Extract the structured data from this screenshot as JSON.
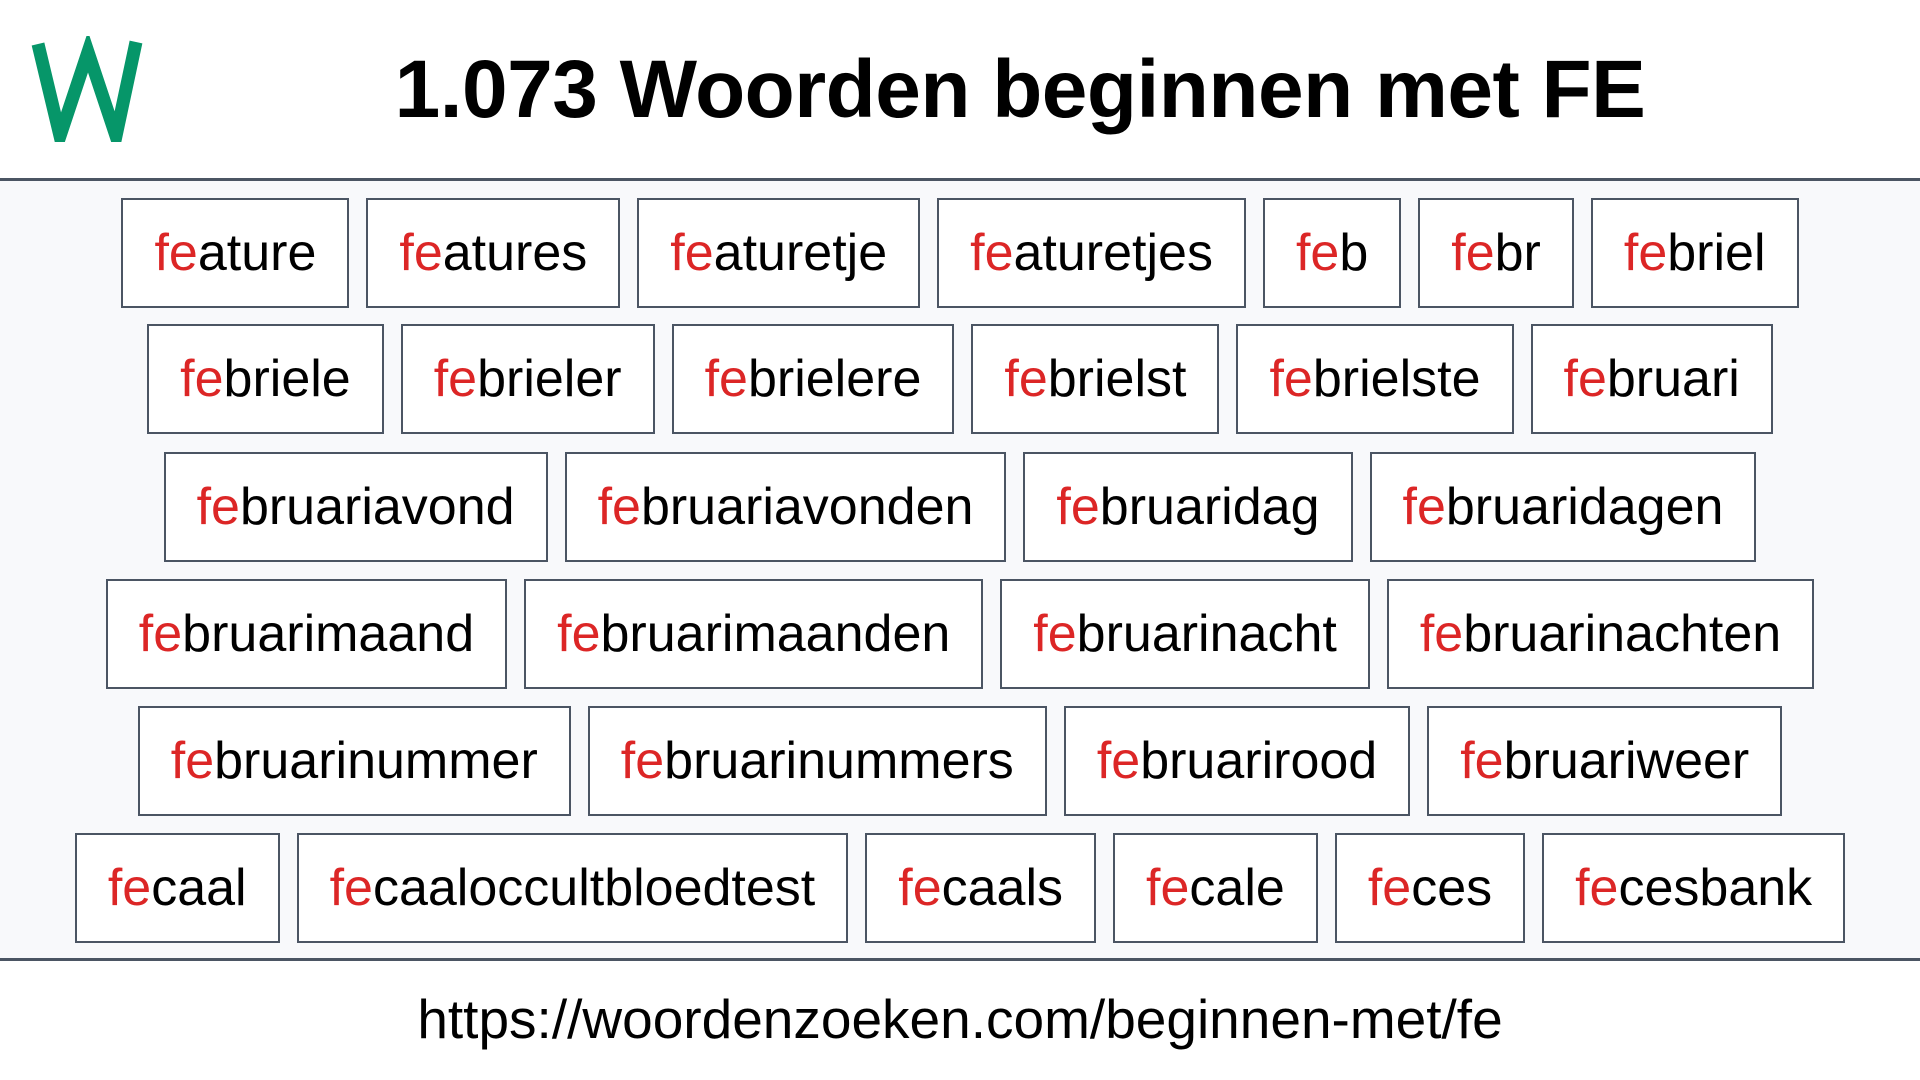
{
  "header": {
    "logo_letter": "W",
    "title": "1.073 Woorden beginnen met FE"
  },
  "colors": {
    "logo_green": "#069669",
    "prefix_red": "#dc2626",
    "border": "#4b5563",
    "content_background": "#f8f9fb"
  },
  "prefix": "fe",
  "rows": [
    [
      {
        "prefix": "fe",
        "rest": "ature"
      },
      {
        "prefix": "fe",
        "rest": "atures"
      },
      {
        "prefix": "fe",
        "rest": "aturetje"
      },
      {
        "prefix": "fe",
        "rest": "aturetjes"
      },
      {
        "prefix": "fe",
        "rest": "b"
      },
      {
        "prefix": "fe",
        "rest": "br"
      },
      {
        "prefix": "fe",
        "rest": "briel"
      }
    ],
    [
      {
        "prefix": "fe",
        "rest": "briele"
      },
      {
        "prefix": "fe",
        "rest": "brieler"
      },
      {
        "prefix": "fe",
        "rest": "brielere"
      },
      {
        "prefix": "fe",
        "rest": "brielst"
      },
      {
        "prefix": "fe",
        "rest": "brielste"
      },
      {
        "prefix": "fe",
        "rest": "bruari"
      }
    ],
    [
      {
        "prefix": "fe",
        "rest": "bruariavond"
      },
      {
        "prefix": "fe",
        "rest": "bruariavonden"
      },
      {
        "prefix": "fe",
        "rest": "bruaridag"
      },
      {
        "prefix": "fe",
        "rest": "bruaridagen"
      }
    ],
    [
      {
        "prefix": "fe",
        "rest": "bruarimaand"
      },
      {
        "prefix": "fe",
        "rest": "bruarimaanden"
      },
      {
        "prefix": "fe",
        "rest": "bruarinacht"
      },
      {
        "prefix": "fe",
        "rest": "bruarinachten"
      }
    ],
    [
      {
        "prefix": "fe",
        "rest": "bruarinummer"
      },
      {
        "prefix": "fe",
        "rest": "bruarinummers"
      },
      {
        "prefix": "fe",
        "rest": "bruarirood"
      },
      {
        "prefix": "fe",
        "rest": "bruariweer"
      }
    ],
    [
      {
        "prefix": "fe",
        "rest": "caal"
      },
      {
        "prefix": "fe",
        "rest": "caaloccultbloedtest"
      },
      {
        "prefix": "fe",
        "rest": "caals"
      },
      {
        "prefix": "fe",
        "rest": "cale"
      },
      {
        "prefix": "fe",
        "rest": "ces"
      },
      {
        "prefix": "fe",
        "rest": "cesbank"
      }
    ]
  ],
  "footer": {
    "url": "https://woordenzoeken.com/beginnen-met/fe"
  }
}
